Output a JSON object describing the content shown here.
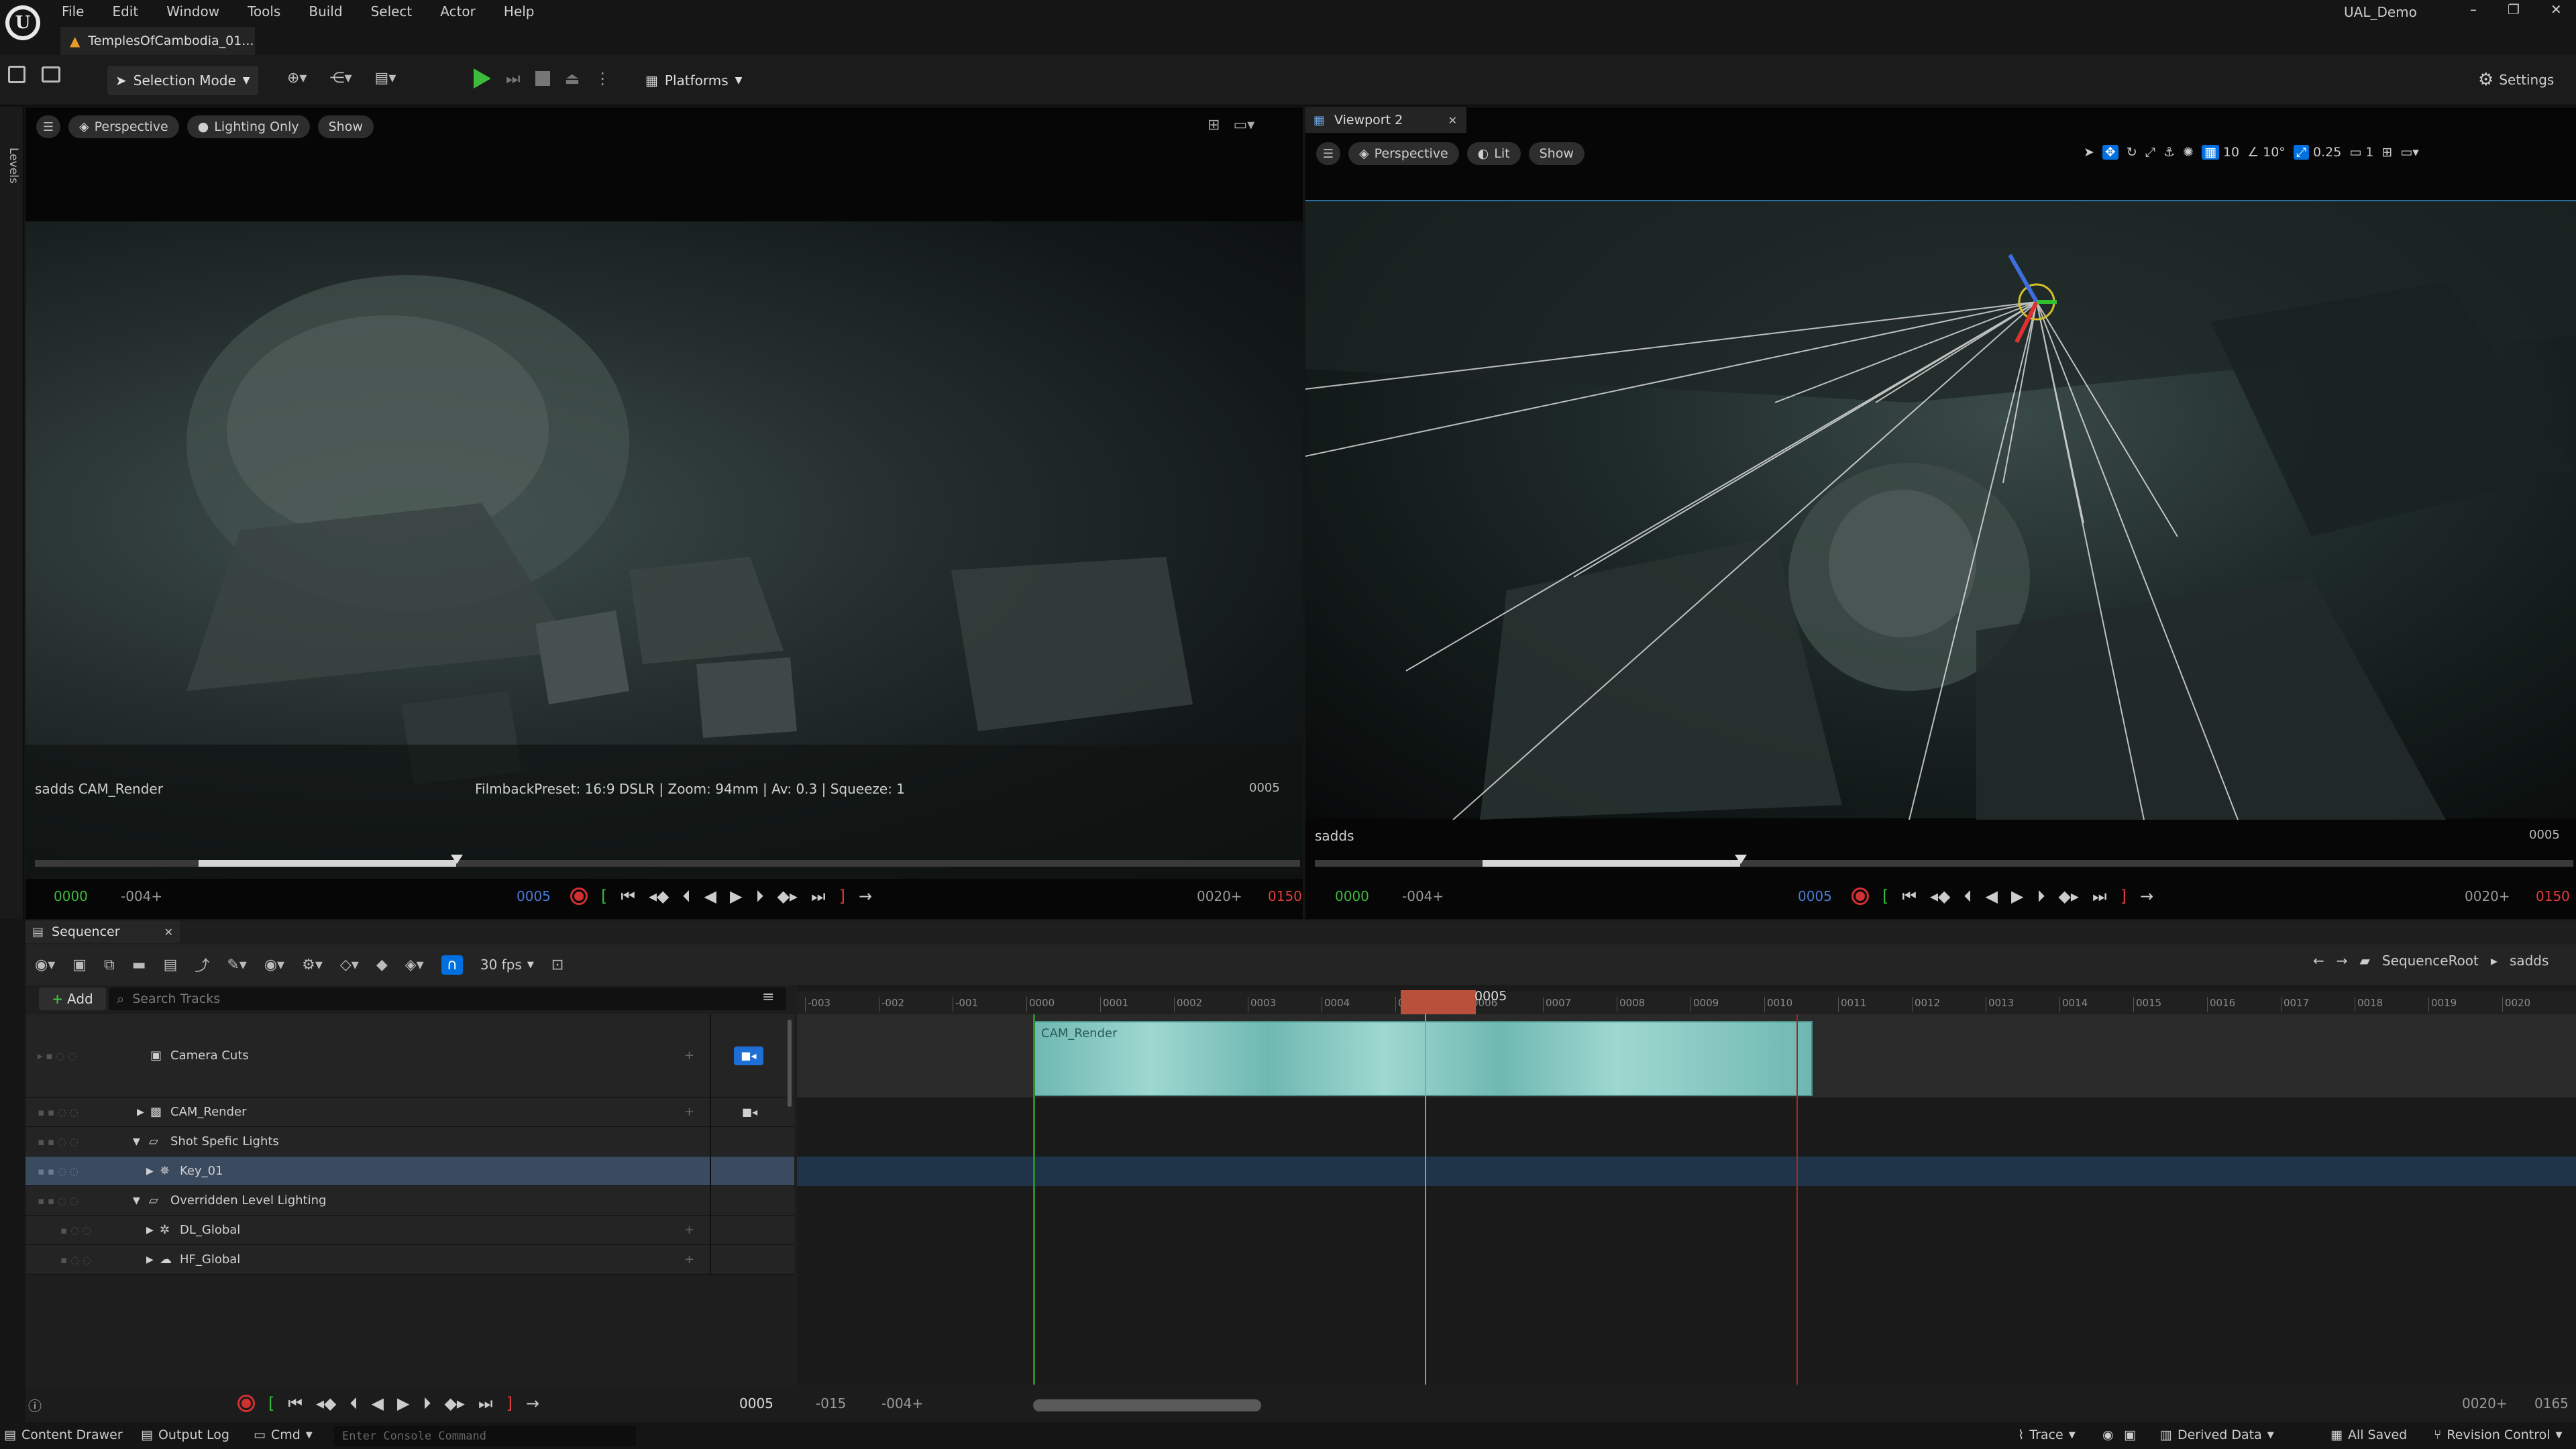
{
  "app": {
    "tab_title": "TemplesOfCambodia_01...",
    "project": "UAL_Demo",
    "menu": [
      "File",
      "Edit",
      "Window",
      "Tools",
      "Build",
      "Select",
      "Actor",
      "Help"
    ]
  },
  "toolbar": {
    "mode_label": "Selection Mode",
    "platforms_label": "Platforms",
    "settings_label": "Settings"
  },
  "sidebar": {
    "levels_label": "Levels"
  },
  "viewport1": {
    "perspective": "Perspective",
    "lighting": "Lighting Only",
    "show": "Show",
    "camera_name": "sadds CAM_Render",
    "filmback": "FilmbackPreset: 16:9 DSLR | Zoom: 94mm | Av: 0.3 | Squeeze: 1",
    "frame_right": "0005",
    "tc_start": "0000",
    "tc_offset": "-004+",
    "tc_current": "0005",
    "tc_end_offset": "0020+",
    "tc_end": "0150"
  },
  "viewport2": {
    "tab_label": "Viewport 2",
    "perspective": "Perspective",
    "lit": "Lit",
    "show": "Show",
    "grid_snap": "10",
    "rot_snap": "10°",
    "scale_snap": "0.25",
    "cam_speed": "1",
    "camera_name": "sadds",
    "frame_right": "0005",
    "tc_start": "0000",
    "tc_offset": "-004+",
    "tc_current": "0005",
    "tc_end_offset": "0020+",
    "tc_end": "0150"
  },
  "sequencer": {
    "tab_label": "Sequencer",
    "fps": "30 fps",
    "add_label": "Add",
    "search_placeholder": "Search Tracks",
    "breadcrumb_root": "SequenceRoot",
    "breadcrumb_current": "sadds",
    "tracks": [
      {
        "label": "Camera Cuts"
      },
      {
        "label": "CAM_Render"
      },
      {
        "label": "Shot Spefic Lights"
      },
      {
        "label": "Key_01"
      },
      {
        "label": "Overridden Level Lighting"
      },
      {
        "label": "DL_Global"
      },
      {
        "label": "HF_Global"
      }
    ],
    "ruler_ticks": [
      "-003",
      "-002",
      "-001",
      "0000",
      "0001",
      "0002",
      "0003",
      "0004",
      "0005",
      "0006",
      "0007",
      "0008",
      "0009",
      "0010",
      "0011",
      "0012",
      "0013",
      "0014",
      "0015",
      "0016",
      "0017",
      "0018",
      "0019",
      "0020"
    ],
    "playhead_label": "0005",
    "clip_label": "CAM_Render",
    "bottom_frame": "0005",
    "bottom_start": "-015",
    "bottom_offset": "-004+",
    "bottom_end_offset": "0020+",
    "bottom_end": "0165"
  },
  "statusbar": {
    "content_drawer": "Content Drawer",
    "output_log": "Output Log",
    "cmd": "Cmd",
    "console_placeholder": "Enter Console Command",
    "trace": "Trace",
    "derived_data": "Derived Data",
    "all_saved": "All Saved",
    "revision_control": "Revision Control"
  },
  "colors": {
    "accent_blue": "#0070e0",
    "record_red": "#d13030",
    "start_green": "#3cba3c",
    "end_red": "#e03c3c",
    "clip_teal": "#7fc8c2",
    "playhead_block": "#b8503c"
  }
}
